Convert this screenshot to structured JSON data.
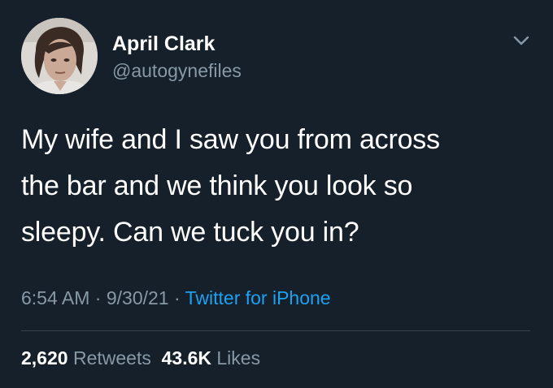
{
  "author": {
    "name": "April Clark",
    "handle": "@autogynefiles",
    "avatar_icon": "profile-photo"
  },
  "menu_icon": "chevron-down-icon",
  "tweet": {
    "lines": [
      "My wife and I saw you from across",
      "the bar and we think you look so",
      "sleepy. Can we tuck you in?"
    ]
  },
  "meta": {
    "time": "6:54 AM",
    "sep1": " · ",
    "date": "9/30/21",
    "sep2": " · ",
    "source": "Twitter for iPhone"
  },
  "stats": {
    "retweets_count": "2,620",
    "retweets_label": "Retweets",
    "likes_count": "43.6K",
    "likes_label": "Likes"
  },
  "colors": {
    "background": "#15202b",
    "text_primary": "#ffffff",
    "text_secondary": "#8899a6",
    "link": "#1da1f2",
    "divider": "#38444d"
  }
}
